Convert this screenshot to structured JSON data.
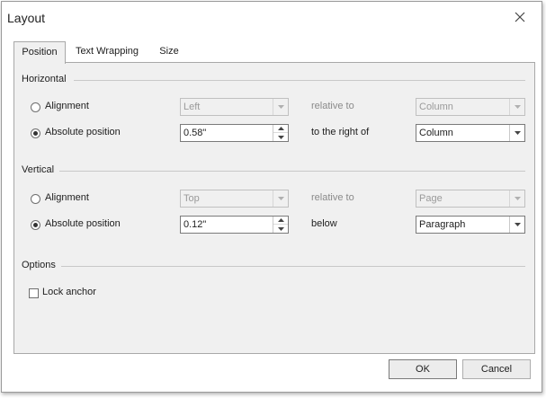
{
  "dialog": {
    "title": "Layout"
  },
  "tabs": [
    {
      "label": "Position",
      "active": true
    },
    {
      "label": "Text Wrapping",
      "active": false
    },
    {
      "label": "Size",
      "active": false
    }
  ],
  "horizontal": {
    "section_title": "Horizontal",
    "alignment": {
      "label": "Alignment",
      "selected": false,
      "value": "Left",
      "relative_label": "relative to",
      "relative_value": "Column"
    },
    "absolute": {
      "label": "Absolute position",
      "selected": true,
      "value": "0.58\"",
      "relative_label": "to the right of",
      "relative_value": "Column"
    }
  },
  "vertical": {
    "section_title": "Vertical",
    "alignment": {
      "label": "Alignment",
      "selected": false,
      "value": "Top",
      "relative_label": "relative to",
      "relative_value": "Page"
    },
    "absolute": {
      "label": "Absolute position",
      "selected": true,
      "value": "0.12\"",
      "relative_label": "below",
      "relative_value": "Paragraph"
    }
  },
  "options": {
    "section_title": "Options",
    "lock_anchor": {
      "label": "Lock anchor",
      "checked": false
    }
  },
  "footer": {
    "ok_label": "OK",
    "cancel_label": "Cancel"
  }
}
